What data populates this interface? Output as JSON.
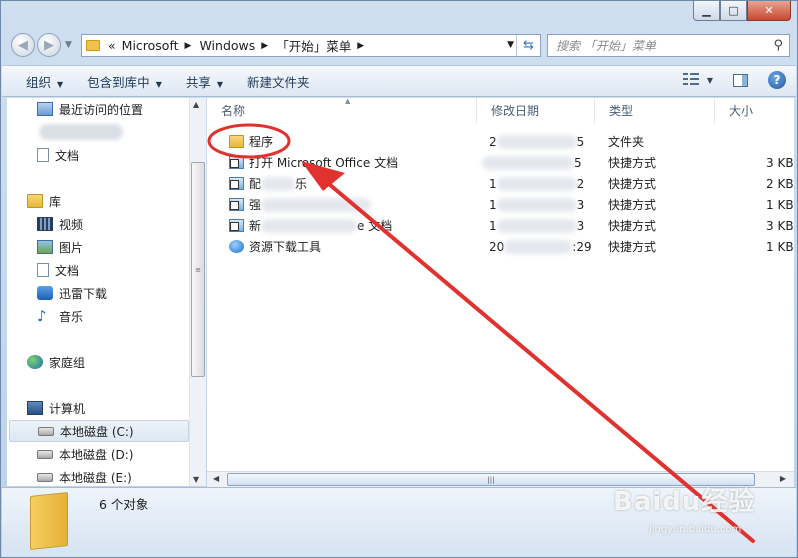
{
  "window": {
    "caption": {
      "minimize": "▁",
      "maximize": "□",
      "close": "✕"
    }
  },
  "address": {
    "chevrons": "«",
    "crumbs": [
      "Microsoft",
      "Windows",
      "「开始」菜单"
    ],
    "separator": "▶"
  },
  "search": {
    "placeholder": "搜索 「开始」菜单"
  },
  "toolbar": {
    "organize": "组织",
    "include_in_library": "包含到库中",
    "share": "共享",
    "new_folder": "新建文件夹"
  },
  "navpane": {
    "recent": "最近访问的位置",
    "documents_top": "文档",
    "libraries": "库",
    "videos": "视频",
    "pictures": "图片",
    "documents": "文档",
    "xunlei": "迅雷下载",
    "music": "音乐",
    "homegroup": "家庭组",
    "computer": "计算机",
    "disk_c": "本地磁盘 (C:)",
    "disk_d": "本地磁盘 (D:)",
    "disk_e": "本地磁盘 (E:)"
  },
  "columns": {
    "name": "名称",
    "date": "修改日期",
    "type": "类型",
    "size": "大小"
  },
  "files": [
    {
      "name": "程序",
      "date_visible_start": "2",
      "date_visible_end": "5",
      "type": "文件夹",
      "size": ""
    },
    {
      "name": "打开 Microsoft Office 文档",
      "date_visible_start": "",
      "date_visible_end": "5",
      "type": "快捷方式",
      "size": "3 KB"
    },
    {
      "name_prefix": "配",
      "name_suffix": "乐",
      "date_visible_start": "1",
      "date_visible_end": "2",
      "type": "快捷方式",
      "size": "2 KB"
    },
    {
      "name_prefix": "强",
      "name_suffix": "",
      "date_visible_start": "1",
      "date_visible_end": "3",
      "type": "快捷方式",
      "size": "1 KB"
    },
    {
      "name_prefix": "新",
      "name_suffix": "e 文档",
      "date_visible_start": "1",
      "date_visible_end": "3",
      "type": "快捷方式",
      "size": "3 KB"
    },
    {
      "name": "资源下载工具",
      "date_visible_start": "20",
      "date_visible_end": ":29",
      "type": "快捷方式",
      "size": "1 KB"
    }
  ],
  "status": {
    "count_text": "6 个对象"
  },
  "watermark": {
    "brand": "Baidu经验",
    "url": "jingyan.baidu.com"
  },
  "colors": {
    "annotation_red": "#e0322f",
    "accent_blue": "#1e395b"
  }
}
